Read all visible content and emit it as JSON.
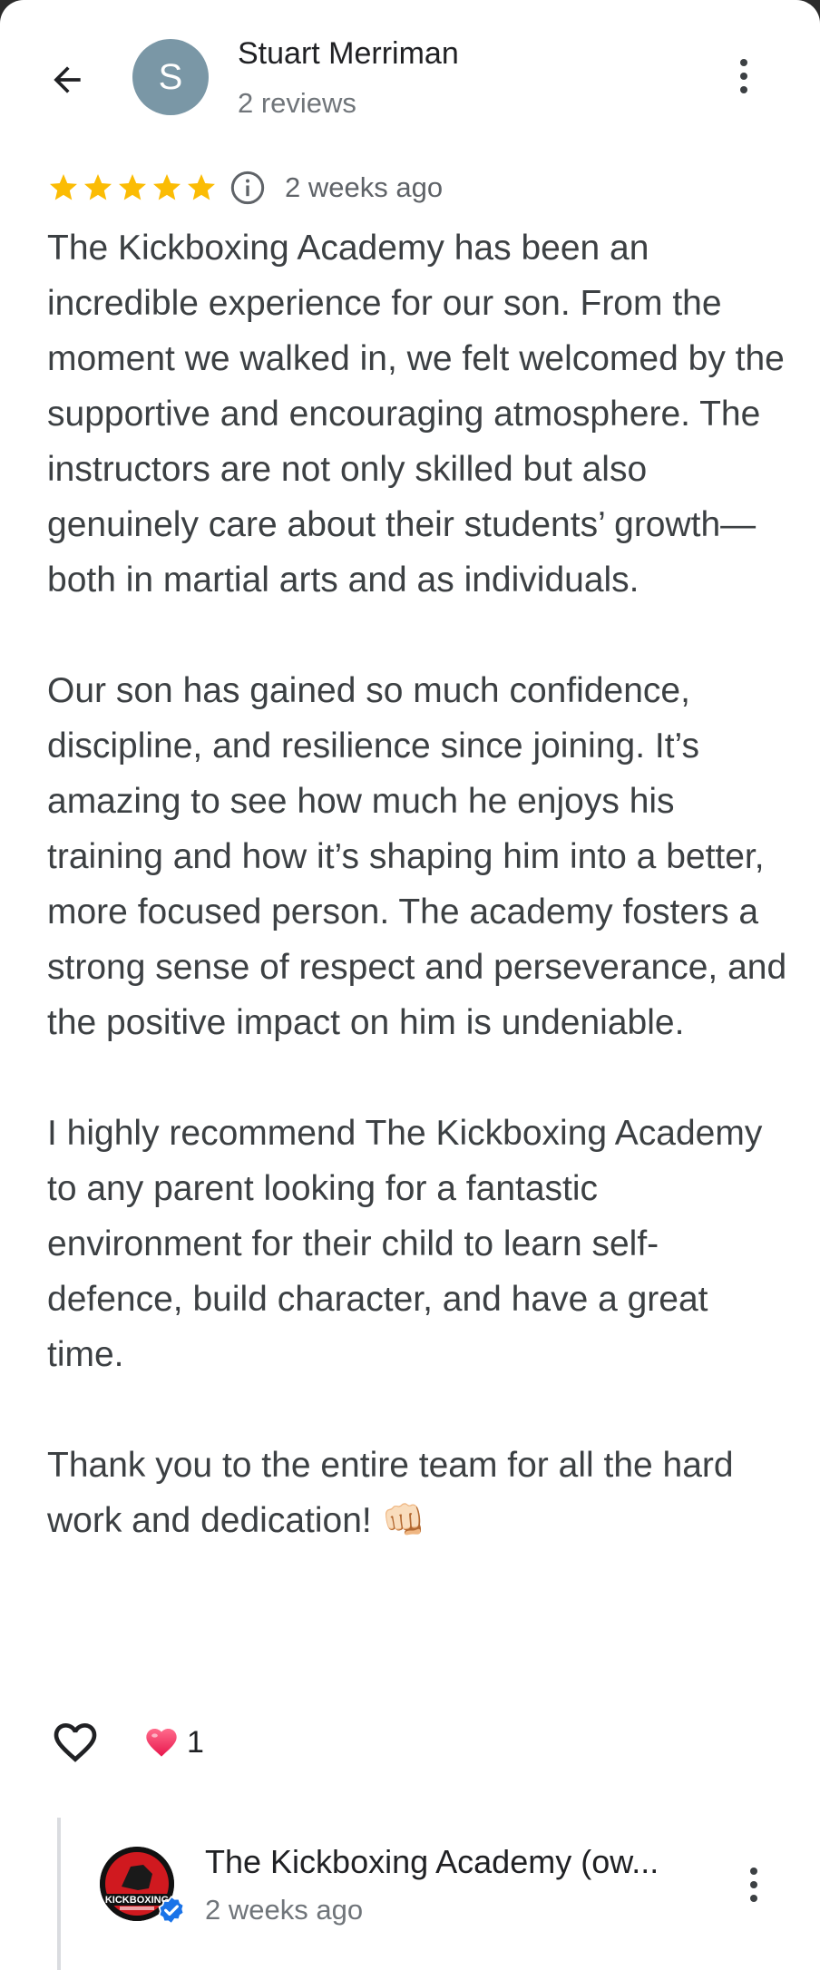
{
  "header": {
    "reviewer_initial": "S",
    "reviewer_name": "Stuart Merriman",
    "reviewer_meta": "2 reviews",
    "avatar_color": "#7a97a6",
    "back_icon": "arrow-left-icon",
    "menu_icon": "more-vert-icon"
  },
  "review": {
    "rating": 5,
    "max_rating": 5,
    "star_color": "#fbbc04",
    "date": "2 weeks ago",
    "paragraphs": [
      "The Kickboxing Academy has been an incredible experience for our son. From the moment we walked in, we felt welcomed by the supportive and encouraging atmosphere. The instructors are not only skilled but also genuinely care about their students’ growth—both in martial arts and as individuals.",
      "Our son has gained so much confidence, discipline, and resilience since joining. It’s amazing to see how much he enjoys his training and how it’s shaping him into a better, more focused person. The academy fosters a strong sense of respect and perseverance, and the positive impact on him is undeniable.",
      "I highly recommend The Kickboxing Academy to any parent looking for a fantastic environment for their child to learn self-defence, build character, and have a great time.",
      "Thank you to the entire team for all the hard work and dedication! 👊🏻"
    ]
  },
  "reactions": {
    "like_icon": "heart-outline-icon",
    "reaction_icon": "heart-emoji-icon",
    "count": "1"
  },
  "owner_reply": {
    "name": "The Kickboxing Academy (ow...",
    "date": "2 weeks ago",
    "logo_text": "KICKBOXING",
    "verified_icon": "verified-badge-icon",
    "badge_color": "#1a73e8"
  }
}
